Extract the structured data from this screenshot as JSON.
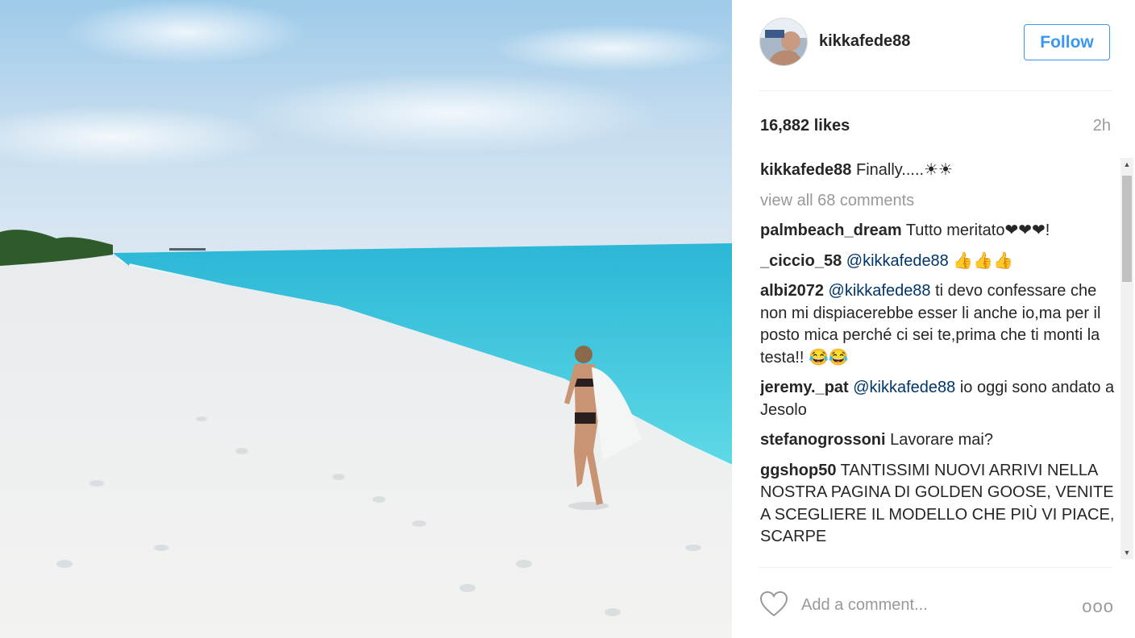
{
  "post": {
    "username": "kikkafede88",
    "follow_label": "Follow",
    "likes": "16,882 likes",
    "time": "2h",
    "caption": {
      "user": "kikkafede88",
      "text": " Finally.....☀☀"
    },
    "view_all": "view all 68 comments",
    "comments": [
      {
        "user": "palmbeach_dream",
        "mention": "",
        "text": " Tutto meritato❤❤❤!"
      },
      {
        "user": "_ciccio_58",
        "mention": "@kikkafede88",
        "text": " 👍👍👍"
      },
      {
        "user": "albi2072",
        "mention": "@kikkafede88",
        "text": " ti devo confessare che non mi dispiacerebbe esser li anche io,ma per il posto mica perché ci sei te,prima che ti monti la testa!! 😂😂"
      },
      {
        "user": "jeremy._pat",
        "mention": "@kikkafede88",
        "text": " io oggi sono andato a Jesolo"
      },
      {
        "user": "stefanogrossoni",
        "mention": "",
        "text": " Lavorare mai?"
      },
      {
        "user": "ggshop50",
        "mention": "",
        "text": " TANTISSIMI NUOVI ARRIVI NELLA NOSTRA PAGINA DI GOLDEN GOOSE, VENITE A SCEGLIERE IL MODELLO CHE PIÙ VI PIACE, SCARPE"
      }
    ],
    "comment_placeholder": "Add a comment...",
    "more_label": "ooo"
  },
  "colors": {
    "accent": "#3897f0",
    "mention": "#003569",
    "muted": "#999999"
  },
  "icons": [
    "heart-icon",
    "more-options-icon",
    "scroll-up-icon",
    "scroll-down-icon"
  ]
}
